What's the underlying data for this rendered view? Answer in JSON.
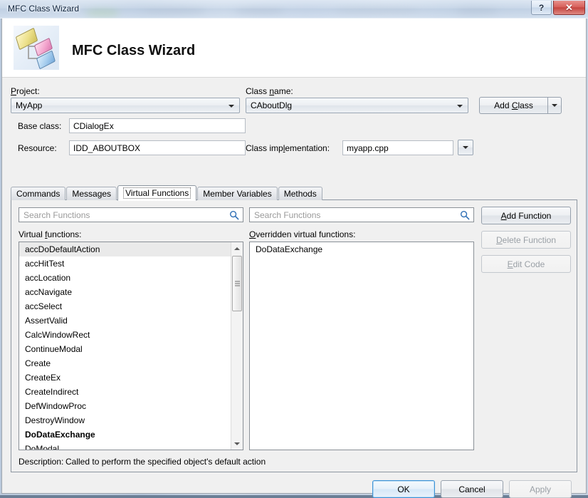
{
  "window": {
    "title": "MFC Class Wizard",
    "help_button": "?",
    "close_button": "✕"
  },
  "header": {
    "title": "MFC Class Wizard",
    "icon": "mfc-class-wizard-icon"
  },
  "form": {
    "project_label": "Project:",
    "project_value": "MyApp",
    "class_name_label": "Class name:",
    "class_name_value": "CAboutDlg",
    "add_class_label": "Add Class",
    "base_class_label": "Base class:",
    "base_class_value": "CDialogEx",
    "resource_label": "Resource:",
    "resource_value": "IDD_ABOUTBOX",
    "class_impl_label": "Class implementation:",
    "class_impl_value": "myapp.cpp"
  },
  "tabs": [
    {
      "label": "Commands",
      "active": false
    },
    {
      "label": "Messages",
      "active": false
    },
    {
      "label": "Virtual Functions",
      "active": true
    },
    {
      "label": "Member Variables",
      "active": false
    },
    {
      "label": "Methods",
      "active": false
    }
  ],
  "panel": {
    "left_search_placeholder": "Search Functions",
    "right_search_placeholder": "Search Functions",
    "left_list_label": "Virtual functions:",
    "right_list_label": "Overridden virtual functions:",
    "virtual_functions": [
      {
        "name": "accDoDefaultAction",
        "selected": true,
        "bold": false
      },
      {
        "name": "accHitTest",
        "selected": false,
        "bold": false
      },
      {
        "name": "accLocation",
        "selected": false,
        "bold": false
      },
      {
        "name": "accNavigate",
        "selected": false,
        "bold": false
      },
      {
        "name": "accSelect",
        "selected": false,
        "bold": false
      },
      {
        "name": "AssertValid",
        "selected": false,
        "bold": false
      },
      {
        "name": "CalcWindowRect",
        "selected": false,
        "bold": false
      },
      {
        "name": "ContinueModal",
        "selected": false,
        "bold": false
      },
      {
        "name": "Create",
        "selected": false,
        "bold": false
      },
      {
        "name": "CreateEx",
        "selected": false,
        "bold": false
      },
      {
        "name": "CreateIndirect",
        "selected": false,
        "bold": false
      },
      {
        "name": "DefWindowProc",
        "selected": false,
        "bold": false
      },
      {
        "name": "DestroyWindow",
        "selected": false,
        "bold": false
      },
      {
        "name": "DoDataExchange",
        "selected": false,
        "bold": true
      },
      {
        "name": "DoModal",
        "selected": false,
        "bold": false
      }
    ],
    "overridden_functions": [
      {
        "name": "DoDataExchange",
        "selected": false,
        "bold": false
      }
    ],
    "add_function_label": "Add Function",
    "delete_function_label": "Delete Function",
    "edit_code_label": "Edit Code",
    "description_label": "Description:",
    "description_text": "Called to perform the specified object's default action"
  },
  "footer": {
    "ok_label": "OK",
    "cancel_label": "Cancel",
    "apply_label": "Apply"
  },
  "colors": {
    "dialog_bg": "#f0f0f0",
    "header_bg": "#ffffff",
    "selection": "#eaeaea",
    "accent": "#3c93d6",
    "close_red": "#c44540",
    "search_icon": "#2f6fb5"
  }
}
